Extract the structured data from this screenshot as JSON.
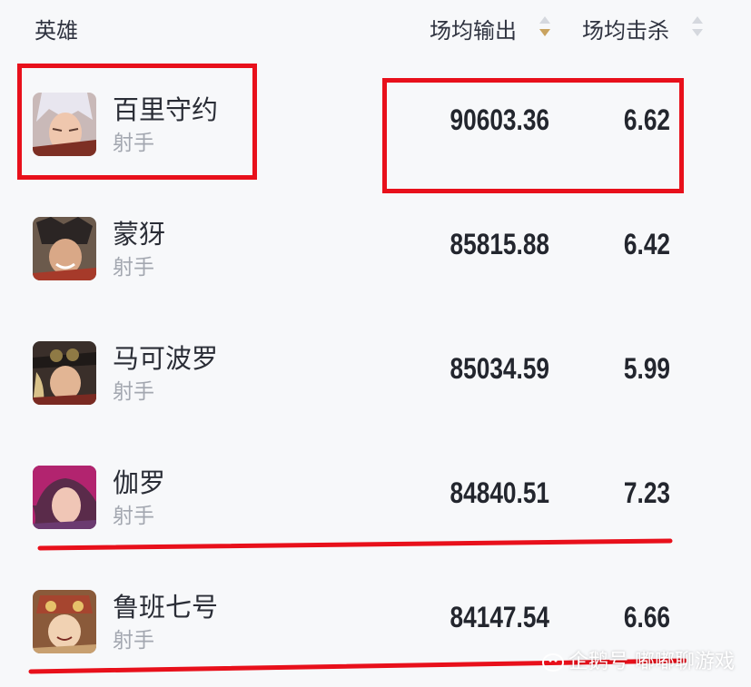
{
  "header": {
    "hero_label": "英雄",
    "damage_label": "场均输出",
    "kills_label": "场均击杀"
  },
  "heroes": [
    {
      "name": "百里守约",
      "role": "射手",
      "damage": "90603.36",
      "kills": "6.62",
      "avatar_icon": "hero-baili-shouyue-avatar"
    },
    {
      "name": "蒙犽",
      "role": "射手",
      "damage": "85815.88",
      "kills": "6.42",
      "avatar_icon": "hero-mengya-avatar"
    },
    {
      "name": "马可波罗",
      "role": "射手",
      "damage": "85034.59",
      "kills": "5.99",
      "avatar_icon": "hero-marco-polo-avatar"
    },
    {
      "name": "伽罗",
      "role": "射手",
      "damage": "84840.51",
      "kills": "7.23",
      "avatar_icon": "hero-jialuo-avatar"
    },
    {
      "name": "鲁班七号",
      "role": "射手",
      "damage": "84147.54",
      "kills": "6.66",
      "avatar_icon": "hero-luban-avatar"
    }
  ],
  "colors": {
    "annotation_red": "#e8101b",
    "sort_active": "#c9a35f",
    "sort_inactive": "#d5d8de",
    "text_primary": "#2a2d36",
    "text_secondary": "#a3a7b0",
    "background": "#f7f8fa"
  },
  "watermark": {
    "text": "企鹅号 嘟嘟聊游戏"
  }
}
